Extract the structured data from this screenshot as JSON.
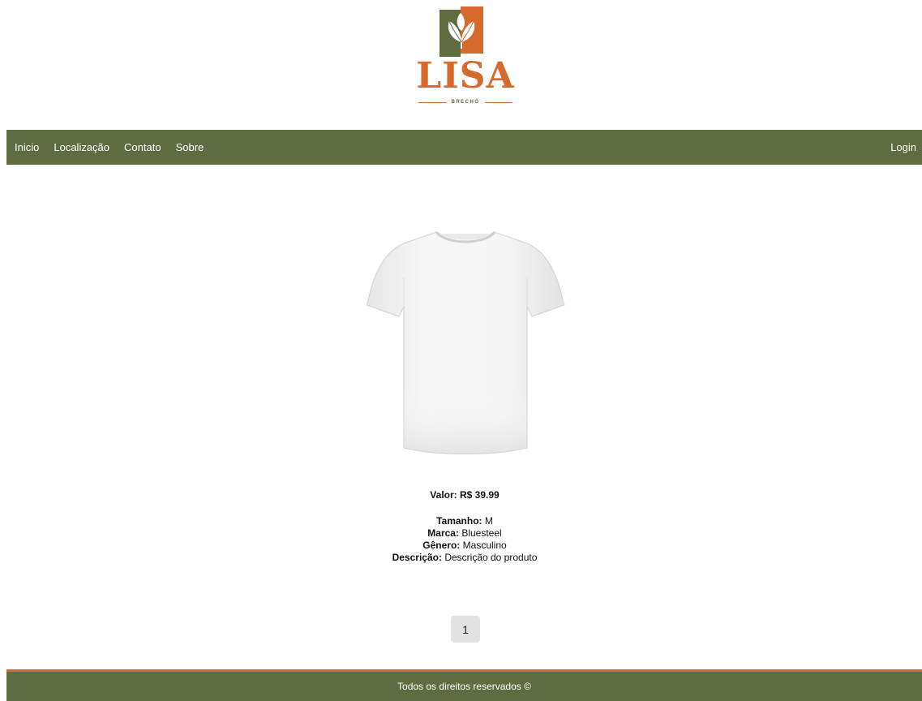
{
  "brand": {
    "name": "LISA",
    "tagline": "BRECHÓ",
    "colors": {
      "primary_green": "#5f6b41",
      "accent_orange": "#d46a2c"
    },
    "logo_icon": "leaf-logo-icon"
  },
  "nav": {
    "items": [
      {
        "label": "Inicio"
      },
      {
        "label": "Localização"
      },
      {
        "label": "Contato"
      },
      {
        "label": "Sobre"
      }
    ],
    "login_label": "Login"
  },
  "product": {
    "image_icon": "white-tshirt-image",
    "price_label": "Valor:",
    "price_value": "R$ 39.99",
    "details": [
      {
        "label": "Tamanho:",
        "value": "M"
      },
      {
        "label": "Marca:",
        "value": "Bluesteel"
      },
      {
        "label": "Gênero:",
        "value": "Masculino"
      },
      {
        "label": "Descrição:",
        "value": "Descrição do produto"
      }
    ]
  },
  "pagination": {
    "current_page": "1"
  },
  "footer": {
    "text": "Todos os direitos reservados ©"
  }
}
